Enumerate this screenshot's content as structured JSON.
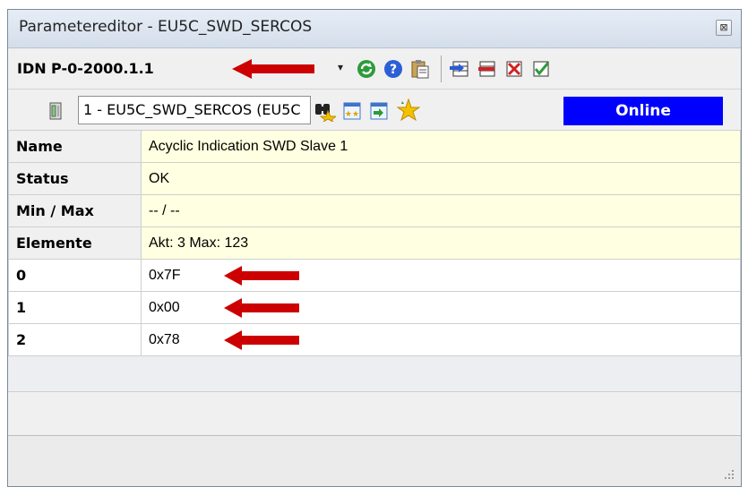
{
  "window": {
    "title": "Parametereditor - EU5C_SWD_SERCOS",
    "close_label": "⊠"
  },
  "toolbar1": {
    "idn_label": "IDN",
    "idn_value": "P-0-2000.1.1",
    "dropdown_glyph": "▾",
    "icons": [
      "refresh-icon",
      "help-icon",
      "paste-icon",
      "insert-row-icon",
      "remove-row-icon",
      "delete-icon",
      "confirm-icon"
    ]
  },
  "toolbar2": {
    "device_select": "1 - EU5C_SWD_SERCOS (EU5C",
    "icons": [
      "device-icon",
      "find-icon",
      "list-icon",
      "import-icon",
      "favorite-icon"
    ],
    "online_status": "Online"
  },
  "colors": {
    "accent_online": "#0000ff",
    "value_highlight": "#ffffe1",
    "arrow": "#cc0000"
  },
  "properties": [
    {
      "key": "Name",
      "value": "Acyclic Indication SWD Slave 1"
    },
    {
      "key": "Status",
      "value": "OK"
    },
    {
      "key": "Min / Max",
      "value": "-- / --"
    },
    {
      "key": "Elemente",
      "value": "Akt: 3  Max: 123"
    }
  ],
  "elements": [
    {
      "index": "0",
      "value": "0x7F"
    },
    {
      "index": "1",
      "value": "0x00"
    },
    {
      "index": "2",
      "value": "0x78"
    }
  ]
}
